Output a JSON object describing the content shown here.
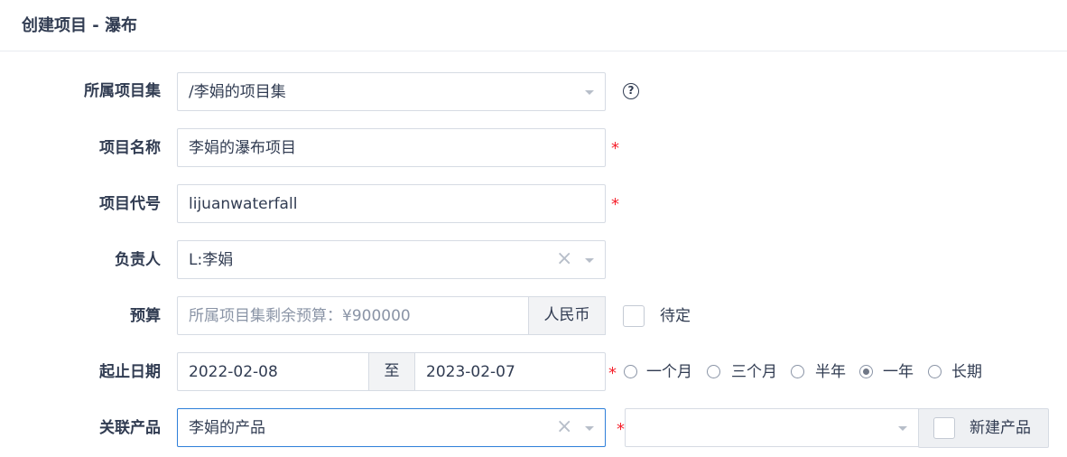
{
  "header": {
    "title": "创建项目 - 瀑布"
  },
  "form": {
    "program": {
      "label": "所属项目集",
      "value": "/李娟的项目集"
    },
    "name": {
      "label": "项目名称",
      "value": "李娟的瀑布项目"
    },
    "code": {
      "label": "项目代号",
      "value": "lijuanwaterfall"
    },
    "owner": {
      "label": "负责人",
      "value": "L:李娟"
    },
    "budget": {
      "label": "预算",
      "placeholder": "所属项目集剩余预算：¥900000",
      "currency": "人民币",
      "pending_label": "待定"
    },
    "dates": {
      "label": "起止日期",
      "begin": "2022-02-08",
      "separator": "至",
      "end": "2023-02-07",
      "options": [
        {
          "label": "一个月",
          "checked": false
        },
        {
          "label": "三个月",
          "checked": false
        },
        {
          "label": "半年",
          "checked": false
        },
        {
          "label": "一年",
          "checked": true
        },
        {
          "label": "长期",
          "checked": false
        }
      ]
    },
    "product": {
      "label": "关联产品",
      "value": "李娟的产品",
      "branch_value": "",
      "new_product_label": "新建产品"
    }
  },
  "required_mark": "*",
  "help_glyph": "?",
  "clear_glyph": "×"
}
